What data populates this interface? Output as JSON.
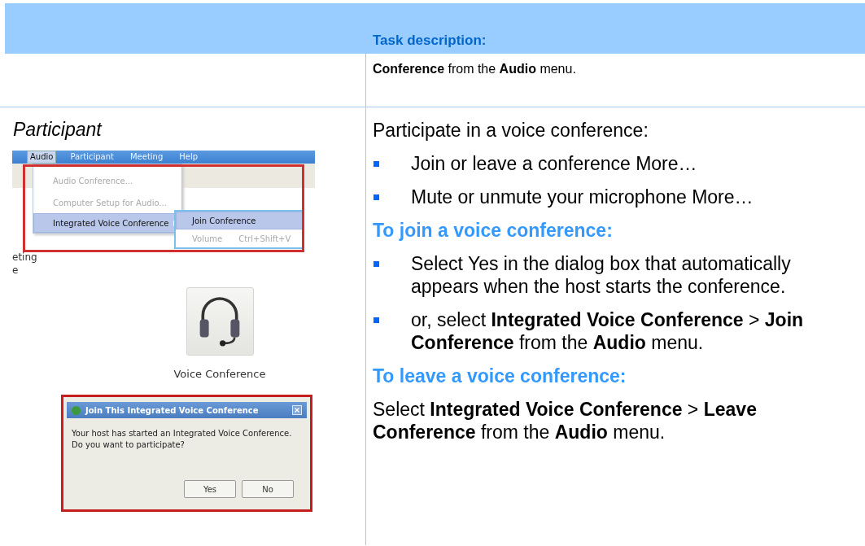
{
  "header": {
    "title": "Task description:"
  },
  "intro_row": {
    "text": "**Conference** from the **Audio** menu."
  },
  "role": "Participant",
  "menu_screenshot": {
    "menubar": [
      {
        "label": "Audio",
        "selected": true
      },
      {
        "label": "Participant",
        "selected": false
      },
      {
        "label": "Meeting",
        "selected": false
      },
      {
        "label": "Help",
        "selected": false
      }
    ],
    "items": [
      {
        "label": "Audio Conference...",
        "disabled": true,
        "highlighted": false,
        "submenu": false
      },
      {
        "label": "Computer Setup for Audio...",
        "disabled": true,
        "highlighted": false,
        "submenu": false
      },
      {
        "label": "Integrated Voice Conference",
        "disabled": false,
        "highlighted": true,
        "submenu": true
      }
    ],
    "submenu": [
      {
        "label": "Join Conference",
        "disabled": false,
        "highlighted": true
      },
      {
        "label": "Volume",
        "shortcut": "Ctrl+Shift+V",
        "disabled": true,
        "highlighted": false
      }
    ],
    "background_fragments": [
      "eting",
      "e"
    ]
  },
  "voice_button": {
    "caption": "Voice Conference"
  },
  "dialog": {
    "title": "Join This Integrated Voice Conference",
    "message": "Your host has started an Integrated Voice Conference. Do you want to participate?",
    "buttons": [
      "Yes",
      "No"
    ]
  },
  "right": {
    "intro": "Participate in a voice conference:",
    "sections": [
      {
        "kind": "bullets",
        "items": [
          "Join or leave a conference More…",
          "Mute or unmute your microphone More…"
        ]
      },
      {
        "kind": "bullets",
        "heading": "To join a voice conference:",
        "items": [
          "Select Yes in the dialog box that automatically appears when the host starts the conference.",
          "or, select **Integrated Voice Conference** > **Join Conference** from the **Audio** menu."
        ]
      },
      {
        "kind": "paragraph",
        "heading": "To leave a voice conference:",
        "text": "Select **Integrated Voice Conference** > **Leave Conference** from the **Audio** menu."
      }
    ]
  }
}
